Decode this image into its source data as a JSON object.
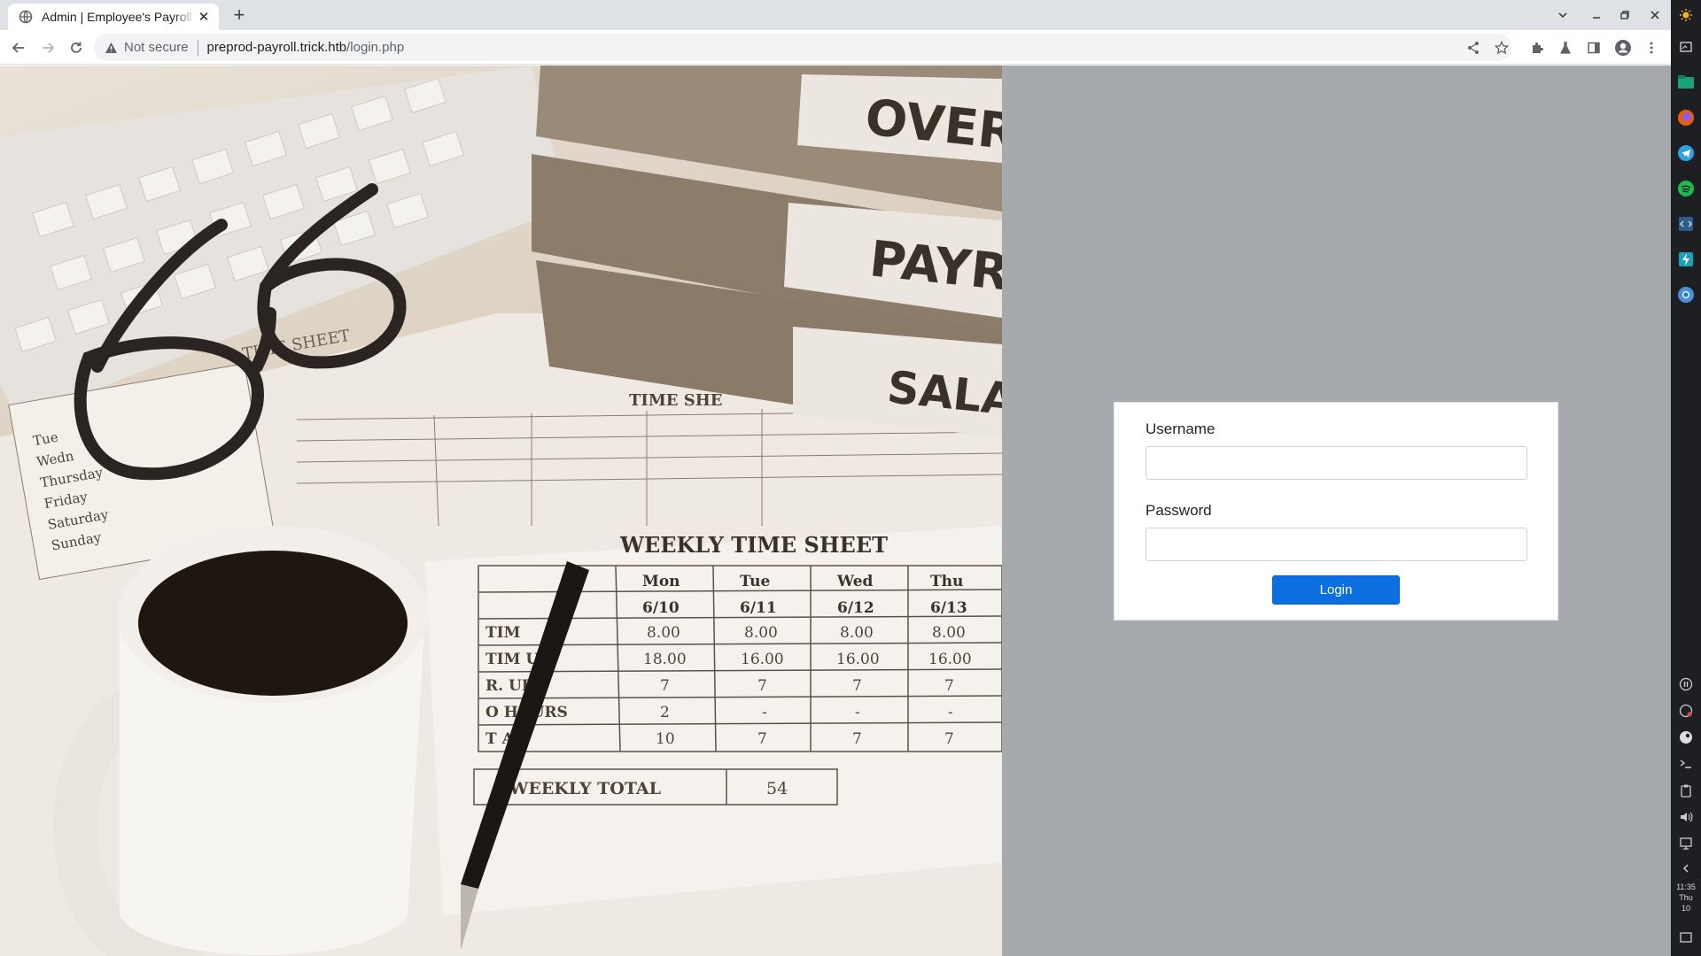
{
  "browser": {
    "tab": {
      "title": "Admin | Employee's Payroll Management System",
      "close_icon": "close-icon",
      "favicon": "globe-icon"
    },
    "new_tab_icon": "plus-icon",
    "toolbar": {
      "back_icon": "arrow-left-icon",
      "forward_icon": "arrow-right-icon",
      "reload_icon": "reload-icon",
      "security_warning": "Not secure",
      "url_host": "preprod-payroll.trick.htb",
      "url_path": "/login.php"
    }
  },
  "hero_image": {
    "binder_labels": [
      "OVER",
      "PAYRO",
      "SALAF"
    ],
    "sheet_titles": [
      "TIME SHEET",
      "TIME SHE",
      "WEEKLY TIME SHEET"
    ],
    "weekly_days": [
      "Mon",
      "Tue",
      "Wed",
      "Thu"
    ],
    "weekly_dates": [
      "6/10",
      "6/11",
      "6/12",
      "6/13"
    ],
    "weekly_rows": [
      {
        "label": "TIM",
        "values": [
          "8.00",
          "8.00",
          "8.00",
          "8.00"
        ]
      },
      {
        "label": "TIM  UT",
        "values": [
          "18.00",
          "16.00",
          "16.00",
          "16.00"
        ]
      },
      {
        "label": "R.   URS",
        "values": [
          "7",
          "7",
          "7",
          "7"
        ]
      },
      {
        "label": "O    HOURS",
        "values": [
          "2",
          "-",
          "-",
          "-"
        ]
      },
      {
        "label": "T    AL",
        "values": [
          "10",
          "7",
          "7",
          "7"
        ]
      }
    ],
    "weekly_total_label": "WEEKLY TOTAL",
    "weekly_total_value": "54",
    "left_sheet_days": [
      "Tue",
      "Wedn",
      "Thursday",
      "Friday",
      "Saturday",
      "Sunday"
    ]
  },
  "login": {
    "username_label": "Username",
    "username_value": "",
    "password_label": "Password",
    "password_value": "",
    "submit_label": "Login"
  },
  "os_panel": {
    "time": "11:35",
    "day": "Thu",
    "date": "10"
  },
  "colors": {
    "page_background": "#a6a9ad",
    "button_primary": "#0b6fe0"
  }
}
